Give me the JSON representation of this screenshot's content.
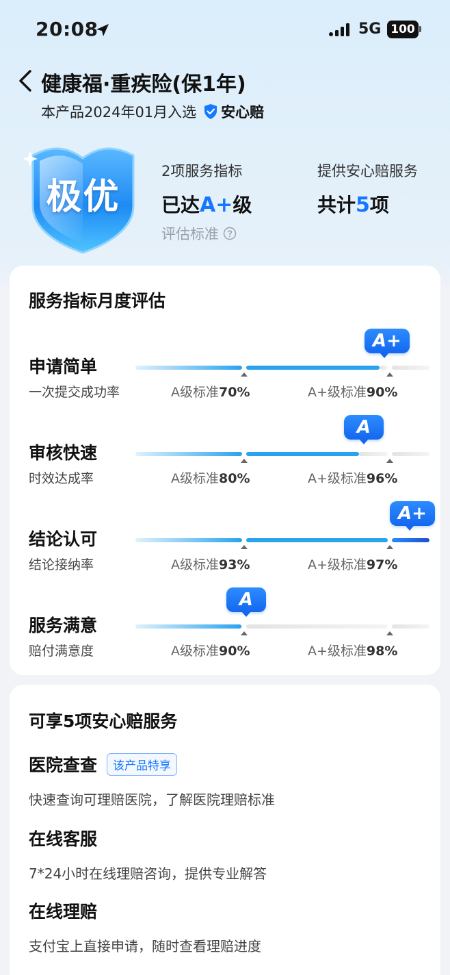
{
  "status_bar": {
    "time": "20:08",
    "network": "5G",
    "battery": "100"
  },
  "header": {
    "title": "健康福·重疾险(保1年)",
    "subtitle_prefix": "本产品2024年01月入选",
    "brand": "安心赔"
  },
  "hero": {
    "badge": "极优",
    "metric_a_label": "2项服务指标",
    "metric_a_prefix": "已达",
    "metric_a_highlight": "A+",
    "metric_a_suffix": "级",
    "metric_b_label": "提供安心赔服务",
    "metric_b_prefix": "共计",
    "metric_b_highlight": "5",
    "metric_b_suffix": "项",
    "eval_standard": "评估标准"
  },
  "evaluation": {
    "title": "服务指标月度评估",
    "std_a_prefix": "A级标准",
    "std_ap_prefix": "A+级标准",
    "rows": [
      {
        "name": "申请简单",
        "desc": "一次提交成功率",
        "std_a": "70%",
        "std_ap": "90%",
        "grade": "A+",
        "fill_fraction": 0.83
      },
      {
        "name": "审核快速",
        "desc": "时效达成率",
        "std_a": "80%",
        "std_ap": "96%",
        "grade": "A",
        "fill_fraction": 0.76
      },
      {
        "name": "结论认可",
        "desc": "结论接纳率",
        "std_a": "93%",
        "std_ap": "97%",
        "grade": "A+",
        "fill_fraction": 1.0
      },
      {
        "name": "服务满意",
        "desc": "赔付满意度",
        "std_a": "90%",
        "std_ap": "98%",
        "grade": "A",
        "fill_fraction": 0.36
      }
    ]
  },
  "services": {
    "title": "可享5项安心赔服务",
    "items": [
      {
        "name": "医院查查",
        "badge": "该产品特享",
        "desc": "快速查询可理赔医院，了解医院理赔标准"
      },
      {
        "name": "在线客服",
        "badge": "",
        "desc": "7*24小时在线理赔咨询，提供专业解答"
      },
      {
        "name": "在线理赔",
        "badge": "",
        "desc": "支付宝上直接申请，随时查看理赔进度"
      }
    ]
  },
  "colors": {
    "accent": "#1677ff",
    "track_gray": "#e3e3e3",
    "bar_light": "#bfe4fb",
    "bar_mid": "#29a3ee"
  }
}
